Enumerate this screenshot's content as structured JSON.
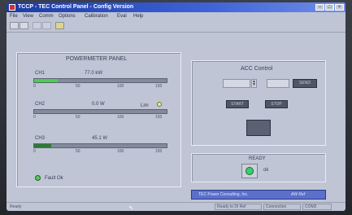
{
  "window": {
    "title": "TCCP - TEC Control Panel - Config Version"
  },
  "menu": [
    "File",
    "View",
    "Comm",
    "Options",
    "Calibration",
    "Eval",
    "Help"
  ],
  "power_panel": {
    "title": "POWERMETER PANEL",
    "meters": [
      {
        "label": "CH1",
        "value_text": "77.0 kW",
        "fraction": 0.18,
        "color": "#47d24b",
        "ticks": [
          "0",
          "50",
          "100",
          "150"
        ]
      },
      {
        "label": "CH2",
        "value_text": "0.0 W",
        "fraction": 0.0,
        "color": "#47d24b",
        "ticks": [
          "0",
          "50",
          "100",
          "150"
        ],
        "indicator_label": "Lim"
      },
      {
        "label": "CH3",
        "value_text": "45.1 W",
        "fraction": 0.13,
        "color": "#2d7b34",
        "ticks": [
          "0",
          "50",
          "100",
          "150"
        ]
      }
    ],
    "status_led": {
      "label": "Fault Ok",
      "color": "#4cd04c"
    }
  },
  "acc_panel": {
    "title": "ACC Control",
    "send_label": "SEND",
    "button_a": "START",
    "button_b": "STOP"
  },
  "ready_panel": {
    "title": "READY",
    "led_label": "ok",
    "led_color": "#3ad06a"
  },
  "brand_banner": {
    "text": "TEC Power Consulting, Inc.",
    "tag": "AW Ref"
  },
  "statusbar": {
    "left": "Ready",
    "right1": "Ready to DI Ref",
    "right2": "Connection",
    "right3": "COM2"
  }
}
